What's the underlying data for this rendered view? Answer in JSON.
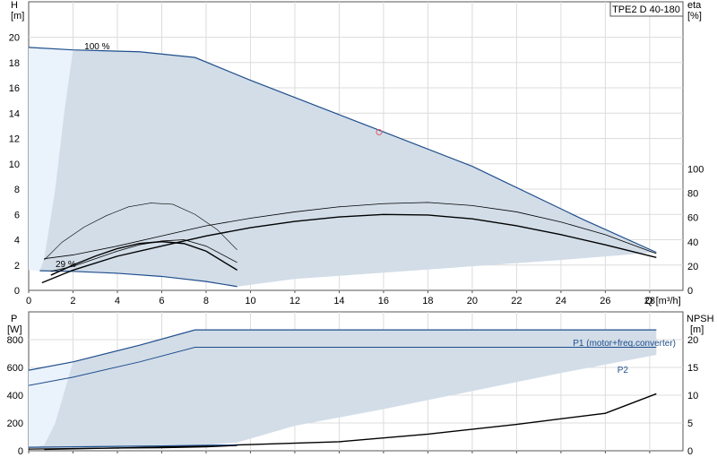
{
  "chart_data": [
    {
      "type": "line",
      "panel": "pump-curves",
      "title": "TPE2 D 40-180",
      "xlabel": "Q [m³/h]",
      "ylabel_left_unit": "H",
      "ylabel_left_bracket": "[m]",
      "ylabel_right_unit": "eta",
      "ylabel_right_bracket": "[%]",
      "xlim": [
        0,
        29.5
      ],
      "ylim_left": [
        0,
        22.8
      ],
      "ylim_right": [
        0,
        100
      ],
      "xticks": [
        "0",
        "2",
        "4",
        "6",
        "8",
        "10",
        "12",
        "14",
        "16",
        "18",
        "20",
        "22",
        "24",
        "26",
        "28"
      ],
      "yticks_left": [
        "0",
        "2",
        "4",
        "6",
        "8",
        "10",
        "12",
        "14",
        "16",
        "18",
        "20"
      ],
      "yticks_right": [
        "0",
        "20",
        "40",
        "60",
        "80",
        "100"
      ],
      "grid": true,
      "annotations": [
        {
          "text": "100 %",
          "x": 1.3,
          "y": 19.2
        },
        {
          "text": "29 %",
          "x": 0.0,
          "y": 2.0
        }
      ],
      "colors": {
        "fill": "#d2dde8",
        "fill_light": "#eaf2fb",
        "max_line": "#1f4e8c",
        "curve": "#000000",
        "operating_point": "#e06070"
      },
      "operating_point": {
        "x": 15.8,
        "y": 12.5
      },
      "series": [
        {
          "points": [
            [
              0,
              19.2
            ],
            [
              2,
              19
            ],
            [
              5,
              18.85
            ],
            [
              7.5,
              18.4
            ],
            [
              10,
              16.6
            ],
            [
              15,
              13.2
            ],
            [
              20,
              9.8
            ],
            [
              25,
              5.6
            ],
            [
              28.3,
              3.0
            ]
          ]
        },
        {
          "points": [
            [
              0.5,
              1.55
            ],
            [
              2,
              1.5
            ],
            [
              4,
              1.35
            ],
            [
              6,
              1.1
            ],
            [
              8,
              0.7
            ],
            [
              9.4,
              0.3
            ]
          ]
        },
        {
          "points": [
            [
              0.6,
              0.6
            ],
            [
              2,
              1.6
            ],
            [
              4,
              2.7
            ],
            [
              6,
              3.5
            ],
            [
              8,
              4.3
            ],
            [
              10,
              4.95
            ],
            [
              12,
              5.45
            ],
            [
              14,
              5.8
            ],
            [
              16,
              6.0
            ],
            [
              18,
              5.95
            ],
            [
              20,
              5.65
            ],
            [
              22,
              5.1
            ],
            [
              24,
              4.4
            ],
            [
              26,
              3.6
            ],
            [
              28.3,
              2.6
            ]
          ]
        },
        {
          "points": [
            [
              1,
              1.2
            ],
            [
              2,
              2.0
            ],
            [
              3,
              2.7
            ],
            [
              4,
              3.3
            ],
            [
              5,
              3.7
            ],
            [
              6,
              3.85
            ],
            [
              7,
              3.7
            ],
            [
              8,
              3.1
            ],
            [
              9.4,
              1.6
            ]
          ]
        },
        {
          "points": [
            [
              0.7,
              2.5
            ],
            [
              2,
              2.8
            ],
            [
              4,
              3.5
            ],
            [
              6,
              4.3
            ],
            [
              8,
              5.1
            ],
            [
              10,
              5.7
            ],
            [
              12,
              6.2
            ],
            [
              14,
              6.6
            ],
            [
              16,
              6.85
            ],
            [
              18,
              6.95
            ],
            [
              20,
              6.7
            ],
            [
              22,
              6.2
            ],
            [
              24,
              5.4
            ],
            [
              26,
              4.4
            ],
            [
              28.3,
              2.9
            ]
          ]
        },
        {
          "points": [
            [
              1,
              1.5
            ],
            [
              2,
              1.9
            ],
            [
              3,
              2.5
            ],
            [
              4,
              3.1
            ],
            [
              5,
              3.6
            ],
            [
              6,
              3.9
            ],
            [
              7,
              4.0
            ],
            [
              8,
              3.5
            ],
            [
              9.4,
              2.2
            ]
          ]
        },
        {
          "points": [
            [
              0.7,
              2.4
            ],
            [
              1.5,
              3.8
            ],
            [
              2.5,
              5.0
            ],
            [
              3.5,
              5.9
            ],
            [
              4.5,
              6.6
            ],
            [
              5.5,
              6.9
            ],
            [
              6.5,
              6.8
            ],
            [
              7.5,
              6.0
            ],
            [
              8.5,
              4.8
            ],
            [
              9.4,
              3.2
            ]
          ]
        }
      ]
    },
    {
      "type": "line",
      "panel": "power-npsh",
      "xlim": [
        0,
        29.5
      ],
      "ylabel_left_unit": "P",
      "ylabel_left_bracket": "[W]",
      "ylabel_right_unit": "NPSH",
      "ylabel_right_bracket": "[m]",
      "ylim_left": [
        0,
        1000
      ],
      "ylim_right": [
        0,
        25
      ],
      "yticks_left": [
        "0",
        "200",
        "400",
        "600",
        "800"
      ],
      "yticks_right": [
        "0",
        "5",
        "10",
        "15",
        "20"
      ],
      "grid": true,
      "series": [
        {
          "name": "P1 (motor+freq.converter)",
          "points": [
            [
              0,
              580
            ],
            [
              2,
              640
            ],
            [
              5,
              760
            ],
            [
              7.5,
              870
            ],
            [
              10,
              870
            ],
            [
              15,
              870
            ],
            [
              20,
              870
            ],
            [
              25,
              870
            ],
            [
              28.3,
              870
            ]
          ]
        },
        {
          "name": "P2",
          "points": [
            [
              0,
              470
            ],
            [
              2,
              530
            ],
            [
              5,
              640
            ],
            [
              7.5,
              745
            ],
            [
              10,
              745
            ],
            [
              15,
              745
            ],
            [
              20,
              745
            ],
            [
              25,
              745
            ],
            [
              28.3,
              745
            ]
          ]
        },
        {
          "points": [
            [
              0.7,
              10
            ],
            [
              4,
              20
            ],
            [
              8,
              35
            ],
            [
              10,
              45
            ],
            [
              14,
              65
            ],
            [
              18,
              120
            ],
            [
              22,
              190
            ],
            [
              26,
              270
            ],
            [
              28.3,
              410
            ]
          ]
        },
        {
          "points": [
            [
              0,
              25
            ],
            [
              3,
              30
            ],
            [
              6,
              35
            ],
            [
              8,
              40
            ],
            [
              9.4,
              42
            ]
          ]
        },
        {
          "points": [
            [
              0,
              12
            ],
            [
              3,
              18
            ],
            [
              6,
              22
            ],
            [
              8,
              28
            ],
            [
              9.4,
              38
            ]
          ]
        }
      ]
    }
  ]
}
